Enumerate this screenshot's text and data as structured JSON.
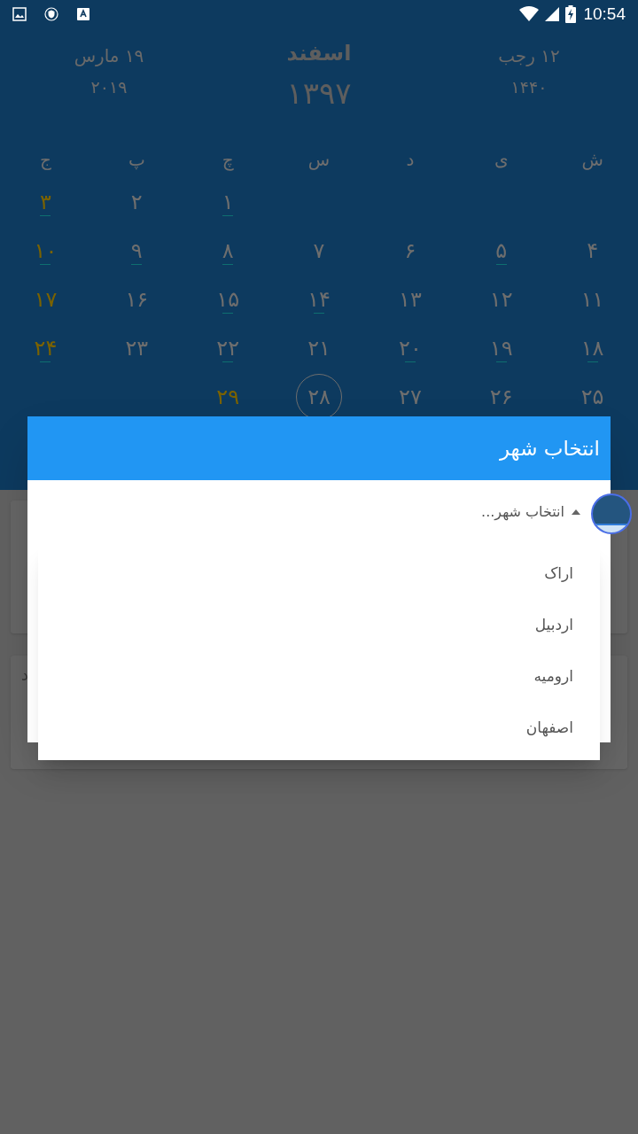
{
  "status_bar": {
    "time": "10:54"
  },
  "header": {
    "gregorian": {
      "date": "۱۹ مارس",
      "year": "۲۰۱۹"
    },
    "persian": {
      "month": "اسفند",
      "year": "۱۳۹۷"
    },
    "hijri": {
      "date": "۱۲ رجب",
      "year": "۱۴۴۰"
    }
  },
  "weekdays": [
    "ش",
    "ی",
    "د",
    "س",
    "چ",
    "پ",
    "ج"
  ],
  "weeks": [
    [
      {
        "kind": "blank"
      },
      {
        "kind": "blank"
      },
      {
        "kind": "blank"
      },
      {
        "kind": "blank"
      },
      {
        "kind": "day",
        "text": "۱",
        "holiday": false,
        "event": true,
        "today": false
      },
      {
        "kind": "day",
        "text": "۲",
        "holiday": false,
        "event": false,
        "today": false
      },
      {
        "kind": "day",
        "text": "۳",
        "holiday": true,
        "event": true,
        "today": false
      }
    ],
    [
      {
        "kind": "day",
        "text": "۴",
        "holiday": false,
        "event": false,
        "today": false
      },
      {
        "kind": "day",
        "text": "۵",
        "holiday": false,
        "event": true,
        "today": false
      },
      {
        "kind": "day",
        "text": "۶",
        "holiday": false,
        "event": false,
        "today": false
      },
      {
        "kind": "day",
        "text": "۷",
        "holiday": false,
        "event": false,
        "today": false
      },
      {
        "kind": "day",
        "text": "۸",
        "holiday": false,
        "event": true,
        "today": false
      },
      {
        "kind": "day",
        "text": "۹",
        "holiday": false,
        "event": true,
        "today": false
      },
      {
        "kind": "day",
        "text": "۱۰",
        "holiday": true,
        "event": true,
        "today": false
      }
    ],
    [
      {
        "kind": "day",
        "text": "۱۱",
        "holiday": false,
        "event": false,
        "today": false
      },
      {
        "kind": "day",
        "text": "۱۲",
        "holiday": false,
        "event": false,
        "today": false
      },
      {
        "kind": "day",
        "text": "۱۳",
        "holiday": false,
        "event": false,
        "today": false
      },
      {
        "kind": "day",
        "text": "۱۴",
        "holiday": false,
        "event": true,
        "today": false
      },
      {
        "kind": "day",
        "text": "۱۵",
        "holiday": false,
        "event": true,
        "today": false
      },
      {
        "kind": "day",
        "text": "۱۶",
        "holiday": false,
        "event": false,
        "today": false
      },
      {
        "kind": "day",
        "text": "۱۷",
        "holiday": true,
        "event": false,
        "today": false
      }
    ],
    [
      {
        "kind": "day",
        "text": "۱۸",
        "holiday": false,
        "event": true,
        "today": false
      },
      {
        "kind": "day",
        "text": "۱۹",
        "holiday": false,
        "event": true,
        "today": false
      },
      {
        "kind": "day",
        "text": "۲۰",
        "holiday": false,
        "event": true,
        "today": false
      },
      {
        "kind": "day",
        "text": "۲۱",
        "holiday": false,
        "event": false,
        "today": false
      },
      {
        "kind": "day",
        "text": "۲۲",
        "holiday": false,
        "event": true,
        "today": false
      },
      {
        "kind": "day",
        "text": "۲۳",
        "holiday": false,
        "event": false,
        "today": false
      },
      {
        "kind": "day",
        "text": "۲۴",
        "holiday": true,
        "event": true,
        "today": false
      }
    ],
    [
      {
        "kind": "day",
        "text": "۲۵",
        "holiday": false,
        "event": false,
        "today": false
      },
      {
        "kind": "day",
        "text": "۲۶",
        "holiday": false,
        "event": false,
        "today": false
      },
      {
        "kind": "day",
        "text": "۲۷",
        "holiday": false,
        "event": false,
        "today": false
      },
      {
        "kind": "day",
        "text": "۲۸",
        "holiday": false,
        "event": false,
        "today": true
      },
      {
        "kind": "day",
        "text": "۲۹",
        "holiday": true,
        "event": false,
        "today": false
      },
      {
        "kind": "blank"
      },
      {
        "kind": "blank"
      }
    ]
  ],
  "background_card": {
    "text": "د"
  },
  "dialog": {
    "title": "انتخاب شهر",
    "dropdown": {
      "placeholder": "انتخاب شهر...",
      "expanded": true,
      "options": [
        {
          "label": "اراک"
        },
        {
          "label": "اردبیل"
        },
        {
          "label": "ارومیه"
        },
        {
          "label": "اصفهان"
        }
      ]
    }
  }
}
